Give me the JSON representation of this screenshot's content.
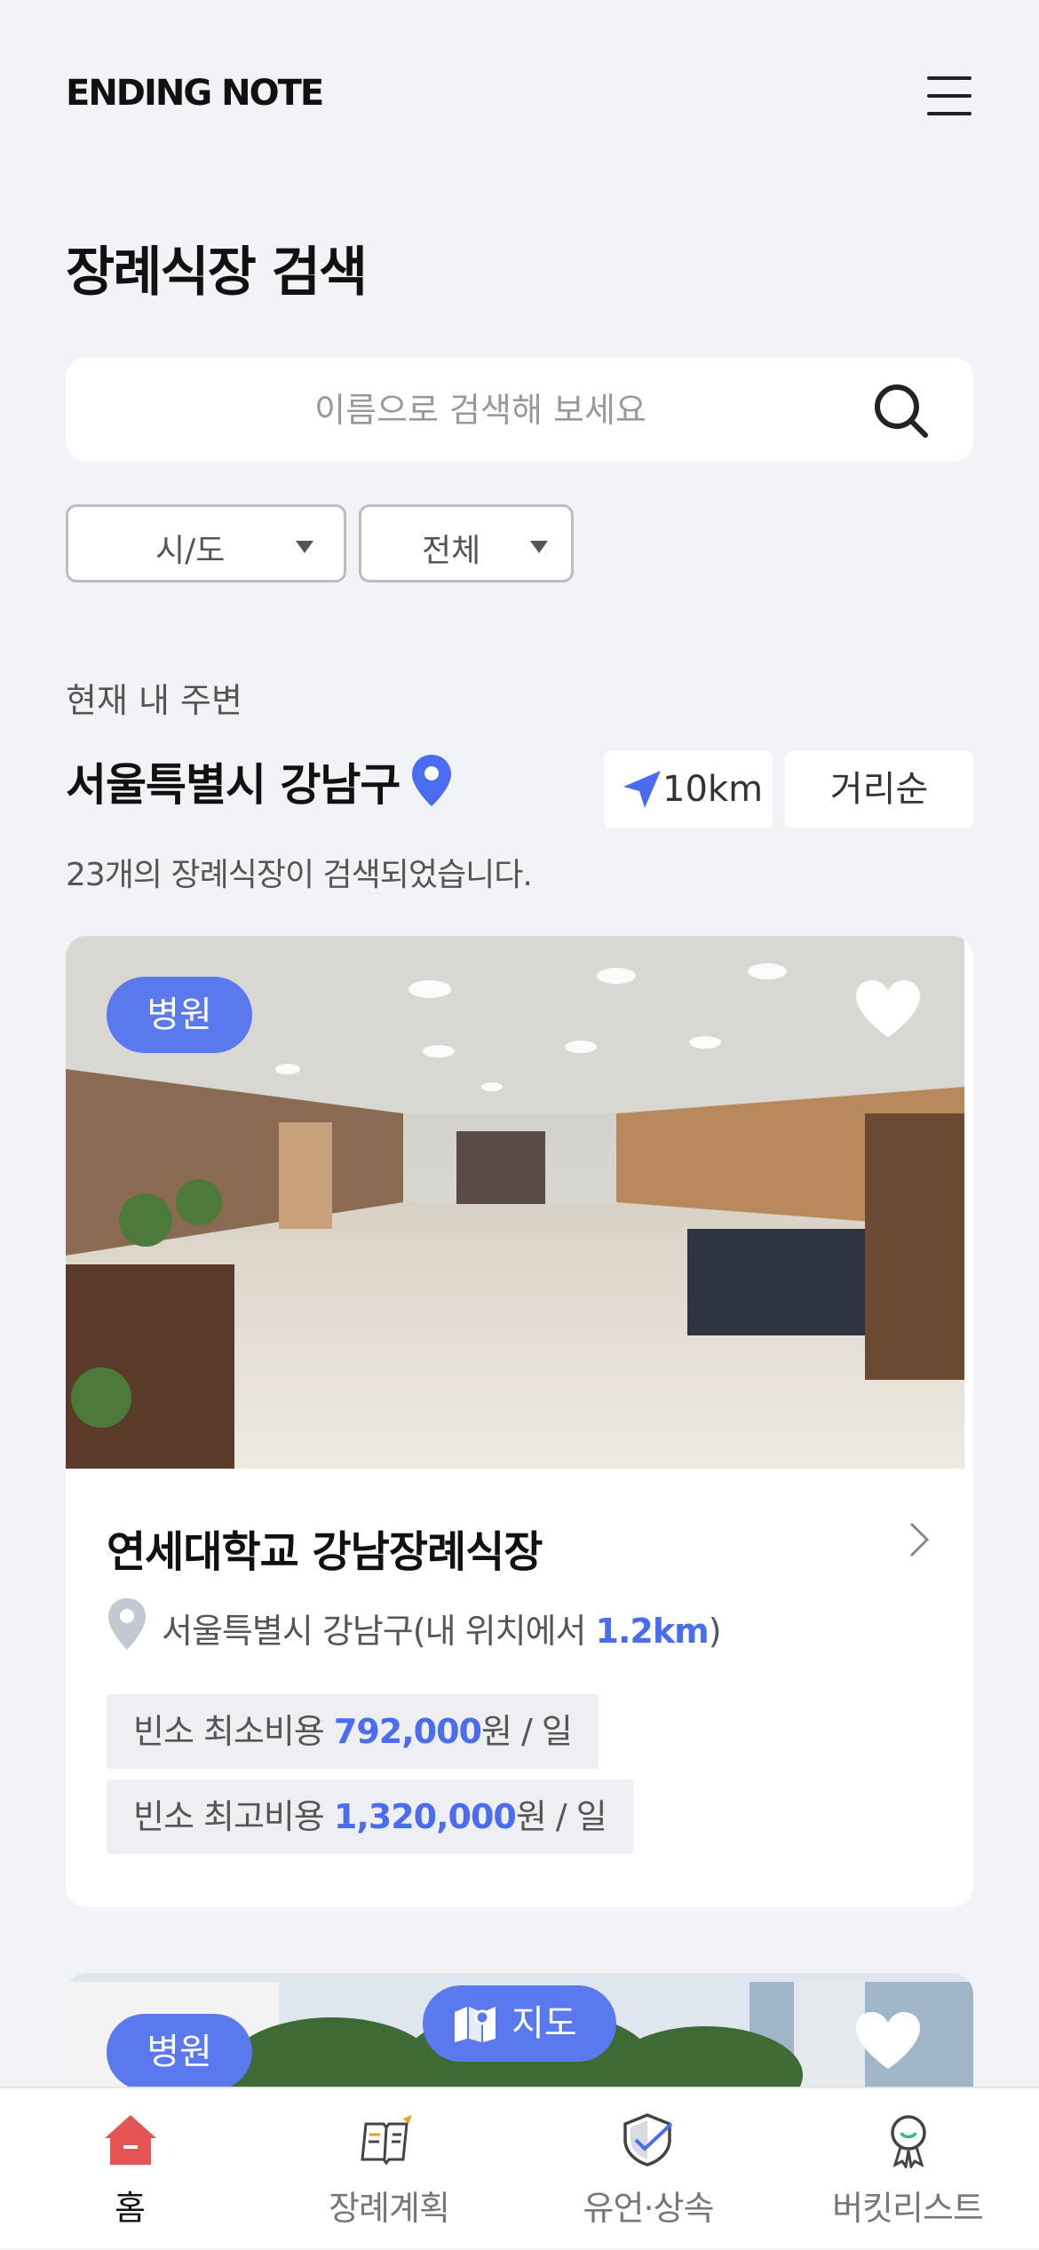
{
  "app": {
    "logo": "ENDING NOTE"
  },
  "page": {
    "title": "장례식장 검색"
  },
  "search": {
    "placeholder": "이름으로 검색해 보세요",
    "value": ""
  },
  "filters": {
    "region": "시/도",
    "district": "전체"
  },
  "nearby": {
    "label": "현재 내 주변",
    "location": "서울특별시 강남구",
    "distance": "10km",
    "sort": "거리순",
    "result_count": "23개의 장례식장이 검색되었습니다."
  },
  "cards": [
    {
      "badge": "병원",
      "favorited": true,
      "name": "연세대학교 강남장례식장",
      "address": "서울특별시 강남구(내 위치에서 ",
      "distance": "1.2km",
      "address_suffix": ")",
      "min_cost_label": "빈소 최소비용 ",
      "min_cost": "792,000",
      "min_cost_unit": "원 / 일",
      "max_cost_label": "빈소 최고비용 ",
      "max_cost": "1,320,000",
      "max_cost_unit": "원 / 일"
    },
    {
      "badge": "병원",
      "favorited": true
    }
  ],
  "map_button": {
    "label": "지도"
  },
  "tabs": [
    {
      "label": "홈",
      "icon": "home-icon",
      "active": true
    },
    {
      "label": "장례계획",
      "icon": "book-icon",
      "active": false
    },
    {
      "label": "유언·상속",
      "icon": "shield-check-icon",
      "active": false
    },
    {
      "label": "버킷리스트",
      "icon": "medal-icon",
      "active": false
    }
  ],
  "colors": {
    "accent": "#5b79ef",
    "background": "#f2f3f6",
    "home_tab": "#e55454"
  }
}
